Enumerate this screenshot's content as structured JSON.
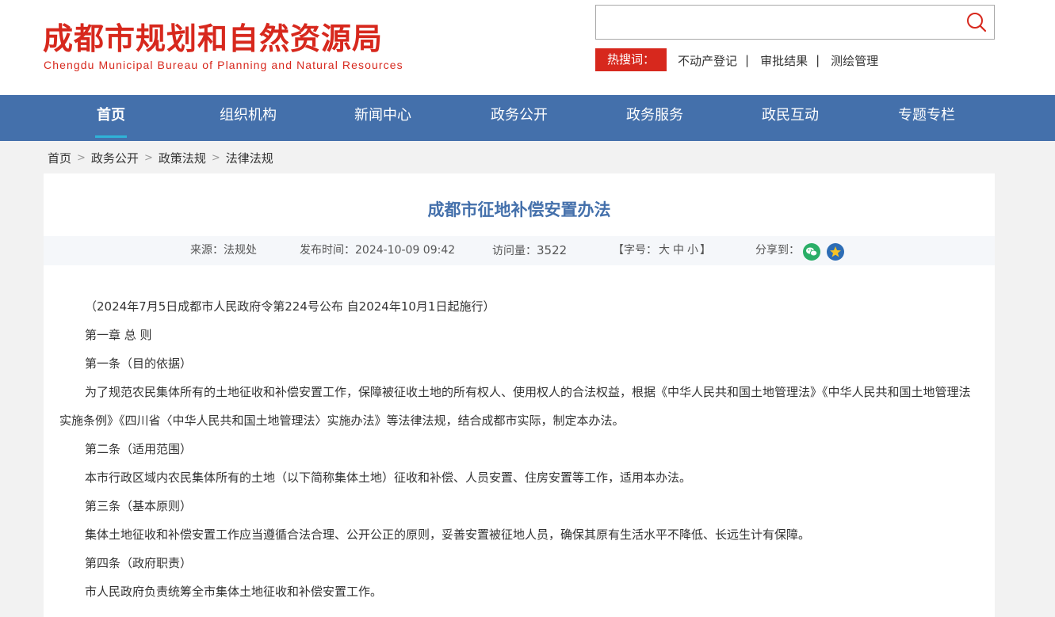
{
  "header": {
    "title_cn": "成都市规划和自然资源局",
    "title_en": "Chengdu Municipal Bureau of Planning and Natural Resources"
  },
  "search": {
    "value": "",
    "placeholder": "",
    "hot_label": "热搜词：",
    "hot_words": [
      "不动产登记",
      "审批结果",
      "测绘管理"
    ],
    "separator": "|"
  },
  "nav": {
    "items": [
      {
        "label": "首页"
      },
      {
        "label": "组织机构"
      },
      {
        "label": "新闻中心"
      },
      {
        "label": "政务公开"
      },
      {
        "label": "政务服务"
      },
      {
        "label": "政民互动"
      },
      {
        "label": "专题专栏"
      }
    ]
  },
  "breadcrumb": {
    "items": [
      "首页",
      "政务公开",
      "政策法规",
      "法律法规"
    ],
    "separator": ">"
  },
  "article": {
    "title": "成都市征地补偿安置办法",
    "source": "来源：法规处",
    "publish_time": "发布时间：2024-10-09 09:42",
    "views_label": "访问量：",
    "views": "3522",
    "font_size_label_open": "【字号：",
    "font_size_options": [
      "大",
      "中",
      "小"
    ],
    "font_size_label_close": "】",
    "share_label": "分享到：",
    "share_icons": [
      "wechat-icon",
      "favorite-icon"
    ],
    "paragraphs": [
      "（2024年7月5日成都市人民政府令第224号公布  自2024年10月1日起施行）",
      "第一章 总 则",
      "第一条（目的依据）",
      "为了规范农民集体所有的土地征收和补偿安置工作，保障被征收土地的所有权人、使用权人的合法权益，根据《中华人民共和国土地管理法》《中华人民共和国土地管理法实施条例》《四川省〈中华人民共和国土地管理法〉实施办法》等法律法规，结合成都市实际，制定本办法。",
      "第二条（适用范围）",
      "本市行政区域内农民集体所有的土地（以下简称集体土地）征收和补偿、人员安置、住房安置等工作，适用本办法。",
      "第三条（基本原则）",
      "集体土地征收和补偿安置工作应当遵循合法合理、公开公正的原则，妥善安置被征地人员，确保其原有生活水平不降低、长远生计有保障。",
      "第四条（政府职责）",
      "市人民政府负责统筹全市集体土地征收和补偿安置工作。"
    ]
  },
  "colors": {
    "brand_red": "#d7281d",
    "nav_blue": "#4470ab",
    "title_blue": "#4470ab",
    "wechat_green": "#2aae67",
    "favorite_blue": "#2d6db5"
  }
}
